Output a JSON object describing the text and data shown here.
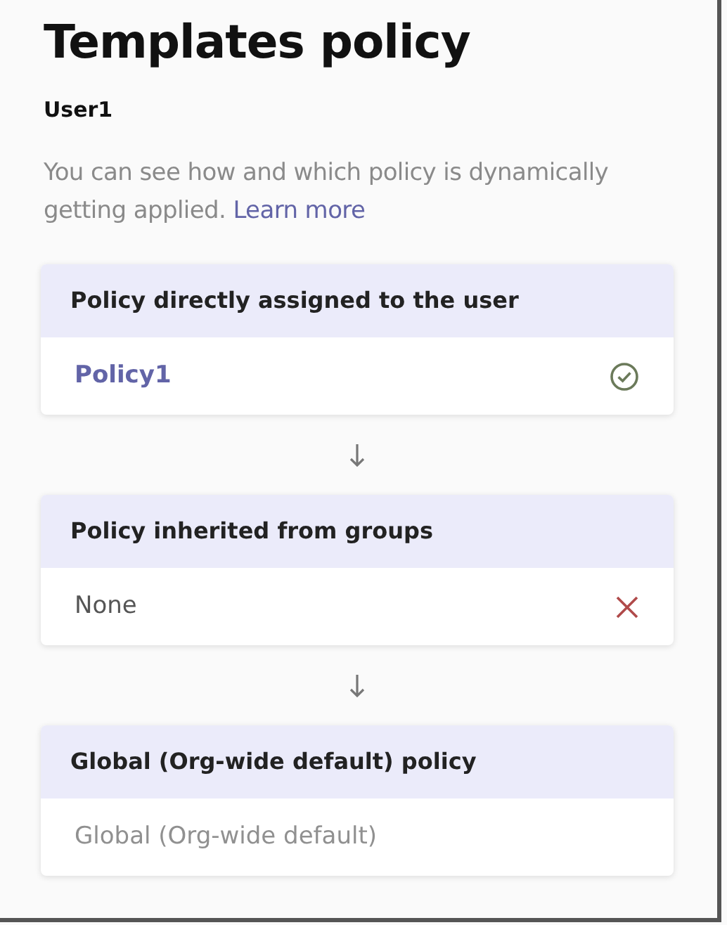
{
  "title": "Templates policy",
  "user": "User1",
  "description": "You can see how and which policy is dynamically getting applied.",
  "learn_more": "Learn more",
  "cards": [
    {
      "header": "Policy directly assigned to the user",
      "value": "Policy1",
      "kind": "assigned",
      "applied": true
    },
    {
      "header": "Policy inherited from groups",
      "value": "None",
      "kind": "empty",
      "applied": false
    },
    {
      "header": "Global (Org-wide default) policy",
      "value": "Global (Org-wide default)",
      "kind": "default"
    }
  ]
}
